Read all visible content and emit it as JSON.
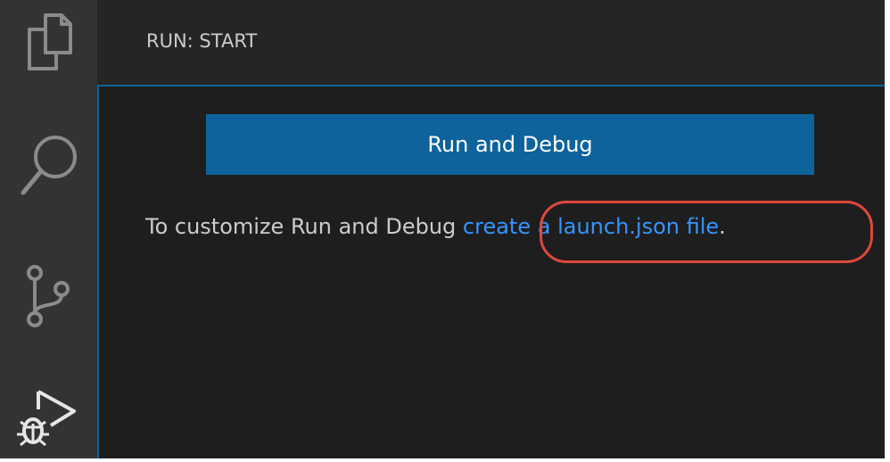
{
  "activity_bar": {
    "items": [
      {
        "name": "explorer",
        "icon": "files-icon"
      },
      {
        "name": "search",
        "icon": "search-icon"
      },
      {
        "name": "source-control",
        "icon": "source-control-icon"
      },
      {
        "name": "run-and-debug",
        "icon": "run-debug-icon",
        "active": true
      }
    ]
  },
  "sidebar": {
    "title": "RUN: START",
    "run_button_label": "Run and Debug",
    "hint_text": "To customize Run and Debug ",
    "hint_link": "create a launch.json file",
    "hint_suffix": "."
  },
  "colors": {
    "activity_bar_bg": "#333333",
    "sidebar_bg": "#252526",
    "button_bg": "#0e639c",
    "link": "#3794ff",
    "highlight": "#e0473b",
    "text": "#cccccc"
  }
}
